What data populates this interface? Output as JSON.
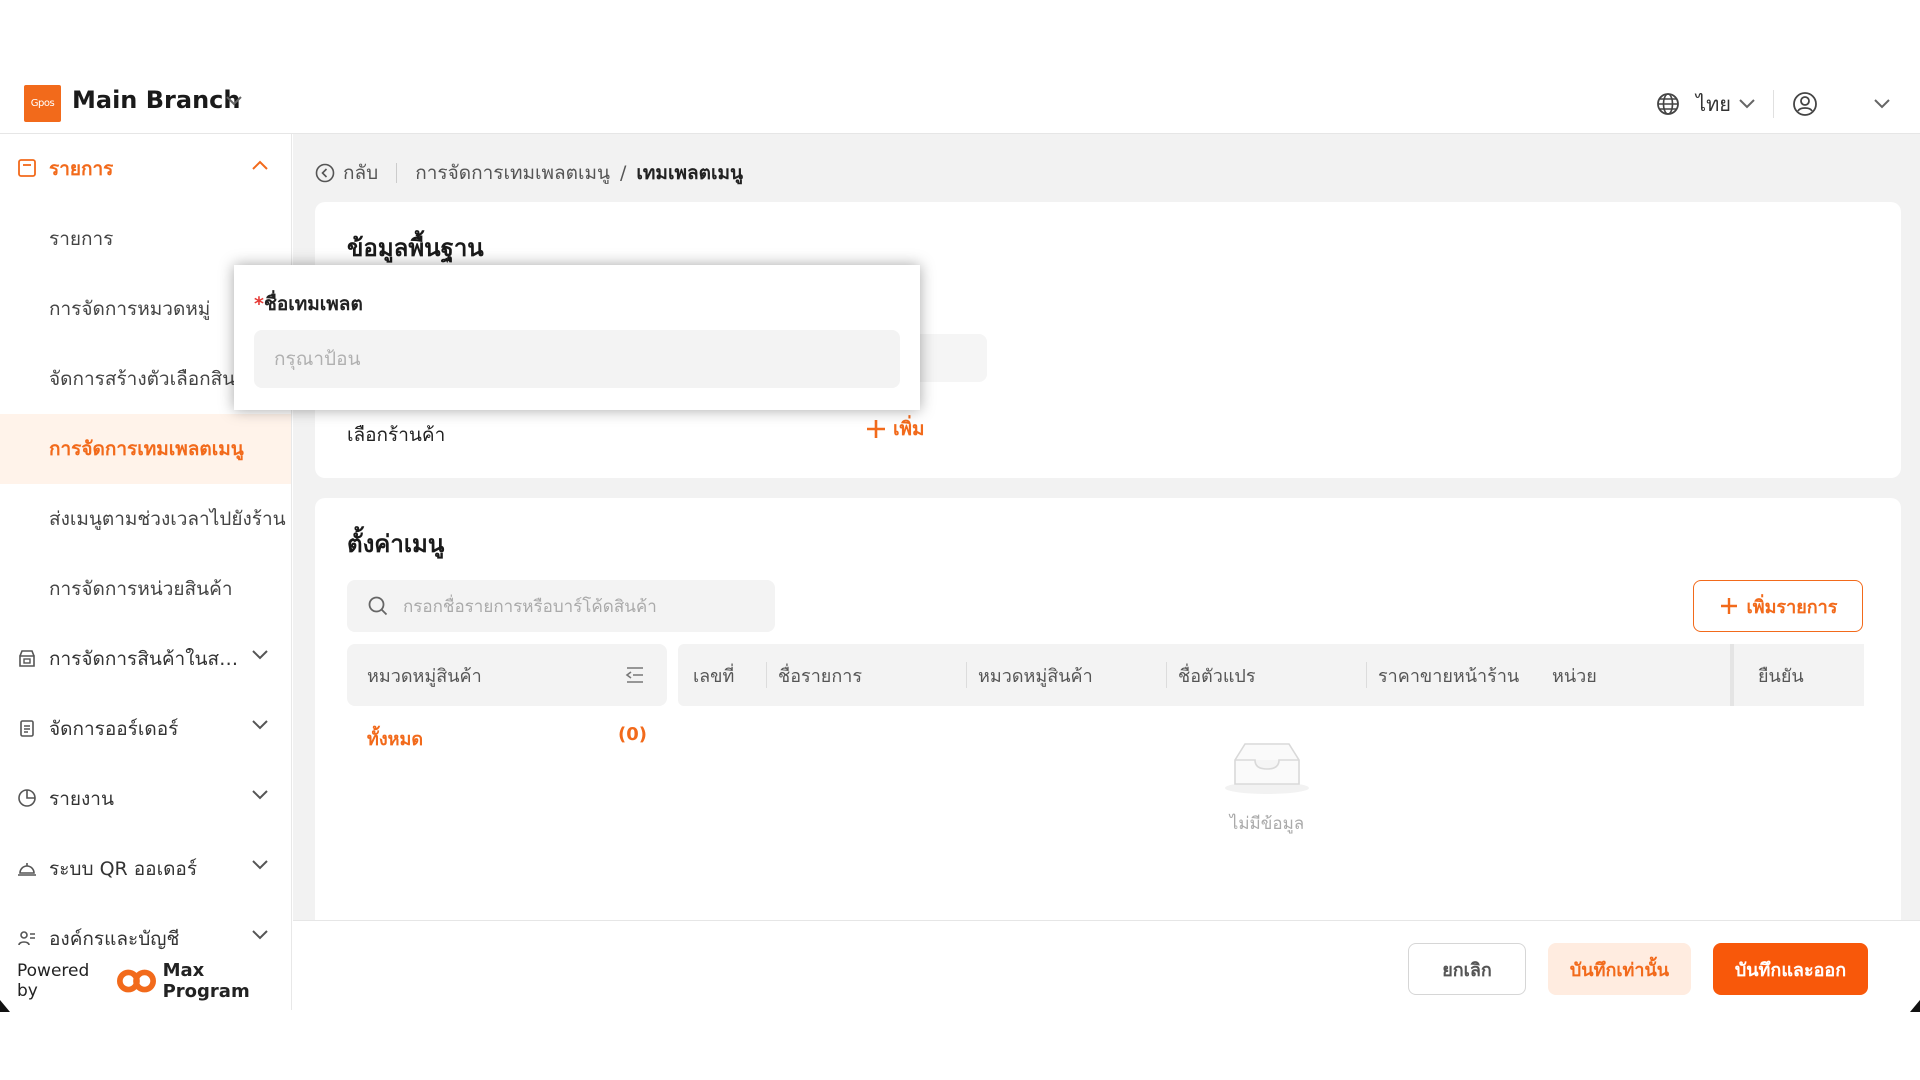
{
  "header": {
    "logo_text": "Gpos",
    "branch_name": "Main Branch",
    "language": "ไทย"
  },
  "sidebar": {
    "groups": [
      {
        "label": "รายการ",
        "icon": "list-box-icon",
        "expanded": true
      },
      {
        "label": "การจัดการสินค้าในสต็...",
        "icon": "store-icon",
        "expanded": false
      },
      {
        "label": "จัดการออร์เดอร์",
        "icon": "clipboard-icon",
        "expanded": false
      },
      {
        "label": "รายงาน",
        "icon": "pie-chart-icon",
        "expanded": false
      },
      {
        "label": "ระบบ QR ออเดอร์",
        "icon": "service-bell-icon",
        "expanded": false
      },
      {
        "label": "องค์กรและบัญชี",
        "icon": "people-icon",
        "expanded": false
      }
    ],
    "items": [
      {
        "label": "รายการ",
        "selected": false
      },
      {
        "label": "การจัดการหมวดหมู่",
        "selected": false
      },
      {
        "label": "จัดการสร้างตัวเลือกสินค้า",
        "selected": false
      },
      {
        "label": "การจัดการเทมเพลตเมนู",
        "selected": true
      },
      {
        "label": "ส่งเมนูตามช่วงเวลาไปยังร้าน",
        "selected": false
      },
      {
        "label": "การจัดการหน่วยสินค้า",
        "selected": false
      }
    ],
    "powered_by": "Powered by",
    "powered_brand": "Max Program"
  },
  "breadcrumb": {
    "back": "กลับ",
    "parent": "การจัดการเทมเพลตเมนู",
    "separator": "/",
    "current": "เทมเพลตเมนู"
  },
  "basic_info": {
    "title": "ข้อมูลพื้นฐาน",
    "store_label": "เลือกร้านค้า",
    "add_label": "เพิ่ม"
  },
  "popup": {
    "required_mark": "*",
    "label": "ชื่อเทมเพลต",
    "placeholder": "กรุณาป้อน"
  },
  "menu_settings": {
    "title": "ตั้งค่าเมนู",
    "search_placeholder": "กรอกชื่อรายการหรือบาร์โค้ดสินค้า",
    "add_item_label": "เพิ่มรายการ",
    "category_header": "หมวดหมู่สินค้า",
    "category_all": "ทั้งหมด",
    "category_all_count": "(0)",
    "columns": [
      "เลขที่",
      "ชื่อรายการ",
      "หมวดหมู่สินค้า",
      "ชื่อตัวแปร",
      "ราคาขายหน้าร้าน",
      "หน่วย",
      "ยืนยัน"
    ],
    "empty_text": "ไม่มีข้อมูล"
  },
  "footer": {
    "cancel": "ยกเลิก",
    "save_only": "บันทึกเท่านั้น",
    "save_exit": "บันทึกและออก"
  },
  "colors": {
    "accent": "#f26a1b",
    "accent_strong": "#f8580a",
    "accent_soft": "#fff3ea"
  }
}
